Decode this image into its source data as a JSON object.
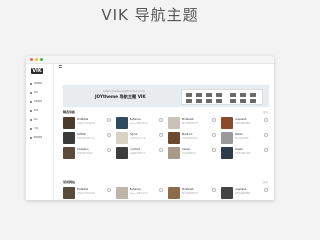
{
  "page_title": "VIK 导航主题",
  "app": {
    "logo_text": "VIK",
    "nav_items": [
      {
        "label": "常用推荐",
        "icon": "star-icon"
      },
      {
        "label": "音乐",
        "icon": "music-icon"
      },
      {
        "label": "社区资讯",
        "icon": "community-icon"
      },
      {
        "label": "影视",
        "icon": "film-icon"
      },
      {
        "label": "设计",
        "icon": "design-icon"
      },
      {
        "label": "工具",
        "icon": "tool-icon"
      },
      {
        "label": "素材资源",
        "icon": "asset-icon"
      }
    ]
  },
  "hero": {
    "url": "https://www.joythemes.com",
    "headline": "JOYtheme 导航主题 VIK"
  },
  "sections": [
    {
      "title": "精选导航",
      "more": "更多",
      "items": [
        {
          "name": "Dribbble",
          "desc": "全球设计师作品社区",
          "color": "#4a3b2a"
        },
        {
          "name": "Behance",
          "desc": "Adobe 创意作品平台",
          "color": "#2f4a5c"
        },
        {
          "name": "Pinterest",
          "desc": "图片灵感收集分享",
          "color": "#c9c2b8"
        },
        {
          "name": "Unsplash",
          "desc": "免费高清摄影图库",
          "color": "#8a4a2a"
        },
        {
          "name": "GitHub",
          "desc": "代码托管与协作平台",
          "color": "#3a3a3a"
        },
        {
          "name": "Figma",
          "desc": "在线协作设计工具",
          "color": "#d8d2c4"
        },
        {
          "name": "Medium",
          "desc": "优质内容阅读写作",
          "color": "#6b4a2f"
        },
        {
          "name": "Notion",
          "desc": "笔记与知识管理",
          "color": "#9a9a9a"
        },
        {
          "name": "Codepen",
          "desc": "前端代码在线演示",
          "color": "#5c4a3a"
        },
        {
          "name": "Iconfont",
          "desc": "矢量图标管理平台",
          "color": "#3d3d3d"
        },
        {
          "name": "Vimeo",
          "desc": "高品质视频分享",
          "color": "#a89a86"
        },
        {
          "name": "Pexels",
          "desc": "免费素材图片视频",
          "color": "#2e3b48"
        }
      ]
    },
    {
      "title": "常用网站",
      "more": "更多",
      "items": [
        {
          "name": "Dribbble",
          "desc": "全球设计师作品社区",
          "color": "#5a4a3a"
        },
        {
          "name": "Behance",
          "desc": "Adobe 创意作品平台",
          "color": "#bdb6a8"
        },
        {
          "name": "Pinterest",
          "desc": "图片灵感收集分享",
          "color": "#8c6a4a"
        },
        {
          "name": "Unsplash",
          "desc": "免费高清摄影图库",
          "color": "#444444"
        }
      ]
    }
  ]
}
